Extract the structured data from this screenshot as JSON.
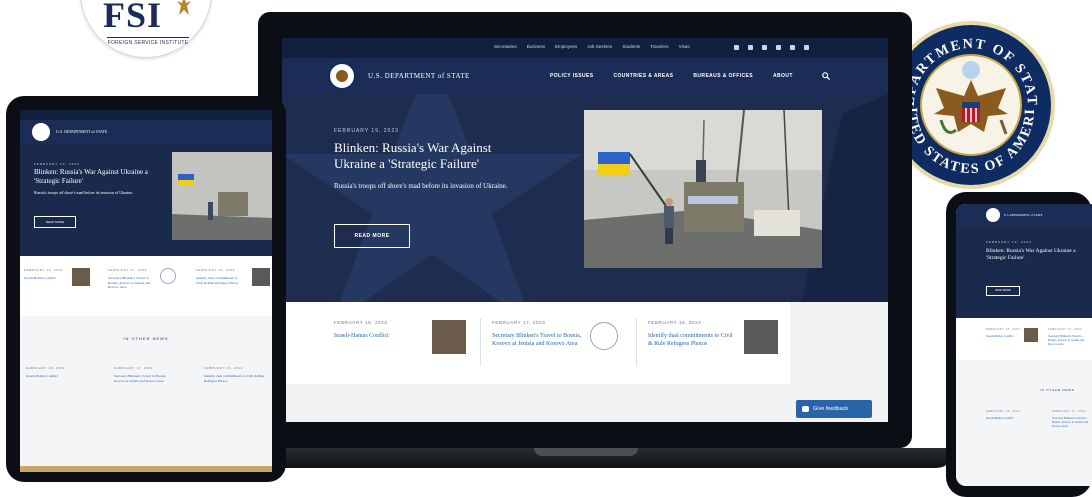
{
  "fsi_logo": {
    "title": "FSI",
    "subtitle": "FOREIGN SERVICE INSTITUTE"
  },
  "seal": {
    "top_text": "DEPARTMENT OF STATE",
    "bottom_text": "UNITED STATES OF AMERICA"
  },
  "site": {
    "brand": "U.S. DEPARTMENT of STATE",
    "utility_links": [
      "Secretaries",
      "Business",
      "Employees",
      "Job Seekers",
      "Students",
      "Travelers",
      "Visas"
    ],
    "social_icons": [
      "facebook-icon",
      "twitter-icon",
      "instagram-icon",
      "youtube-icon",
      "flickr-icon",
      "email-icon"
    ],
    "main_nav": [
      "POLICY ISSUES",
      "COUNTRIES & AREAS",
      "BUREAUS & OFFICES",
      "ABOUT"
    ],
    "hero": {
      "date": "FEBRUARY 19, 2023",
      "headline": "Blinken: Russia's War Against Ukraine a 'Strategic Failure'",
      "summary": "Russia's troops off shore's mad before its invasion of Ukraine.",
      "cta": "READ MORE"
    },
    "news": [
      {
        "date": "FEBRUARY 18, 2023",
        "title": "Israeli-Hamas Conflict"
      },
      {
        "date": "FEBRUARY 17, 2023",
        "title": "Secretary Blinken's Travel to Bosnia, Kosovo at Jenisia and Kosovo Area"
      },
      {
        "date": "FEBRUARY 16, 2023",
        "title": "Identify dual commitments to Civil & Rule Refugees Photos"
      }
    ],
    "in_other_news": "IN OTHER NEWS",
    "feedback": "Give feedback"
  },
  "colors": {
    "navy": "#1b2d57",
    "topbar": "#122040",
    "link": "#2a64a8",
    "device": "#0b0e14"
  }
}
